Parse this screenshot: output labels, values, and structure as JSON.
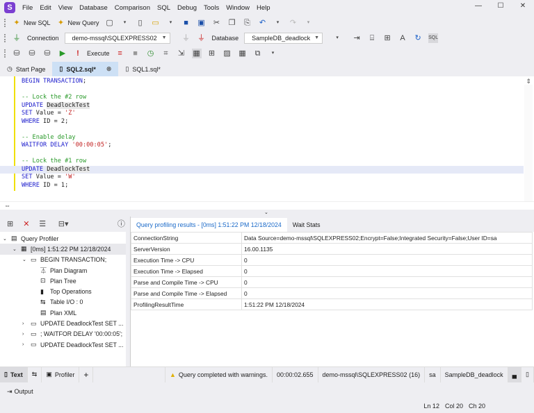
{
  "menu": [
    "File",
    "Edit",
    "View",
    "Database",
    "Comparison",
    "SQL",
    "Debug",
    "Tools",
    "Window",
    "Help"
  ],
  "toolbar": {
    "new_sql": "New SQL",
    "new_query": "New Query",
    "connection_label": "Connection",
    "connection_value": "demo-mssql\\SQLEXPRESS02",
    "database_label": "Database",
    "database_value": "SampleDB_deadlock",
    "execute": "Execute"
  },
  "tabs": [
    {
      "label": "Start Page"
    },
    {
      "label": "SQL2.sql*",
      "active": true
    },
    {
      "label": "SQL1.sql*"
    }
  ],
  "editor": {
    "lines": [
      [
        {
          "t": "BEGIN TRANSACTION",
          "c": "kw"
        },
        {
          "t": ";",
          "c": ""
        }
      ],
      [],
      [
        {
          "t": "-- Lock the #2 row",
          "c": "cm"
        }
      ],
      [
        {
          "t": "UPDATE ",
          "c": "kw"
        },
        {
          "t": "DeadlockTest",
          "c": "id"
        }
      ],
      [
        {
          "t": "SET ",
          "c": "kw"
        },
        {
          "t": "Value = ",
          "c": ""
        },
        {
          "t": "'Z'",
          "c": "st"
        }
      ],
      [
        {
          "t": "WHERE ",
          "c": "kw"
        },
        {
          "t": "ID = 2;",
          "c": ""
        }
      ],
      [],
      [
        {
          "t": "-- Enable delay",
          "c": "cm"
        }
      ],
      [
        {
          "t": "WAITFOR DELAY ",
          "c": "kw"
        },
        {
          "t": "'00:00:05'",
          "c": "st"
        },
        {
          "t": ";",
          "c": ""
        }
      ],
      [],
      [
        {
          "t": "-- Lock the #1 row",
          "c": "cm"
        }
      ],
      [
        {
          "t": "UPDATE ",
          "c": "kw"
        },
        {
          "t": "DeadlockTest",
          "c": "id"
        }
      ],
      [
        {
          "t": "SET ",
          "c": "kw"
        },
        {
          "t": "Value = ",
          "c": ""
        },
        {
          "t": "'W'",
          "c": "st"
        }
      ],
      [
        {
          "t": "WHERE ",
          "c": "kw"
        },
        {
          "t": "ID = 1;",
          "c": ""
        }
      ]
    ],
    "current_line": 12
  },
  "profiler": {
    "root": "Query Profiler",
    "session": "[0ms] 1:51:22 PM 12/18/2024",
    "statement": "BEGIN TRANSACTION;",
    "children": [
      "Plan Diagram",
      "Plan Tree",
      "Top Operations",
      "Table I/O : 0",
      "Plan XML"
    ],
    "others": [
      "UPDATE DeadlockTest   SET ...",
      "; WAITFOR DELAY '00:00:05';",
      "UPDATE DeadlockTest   SET ..."
    ]
  },
  "results": {
    "tabs": [
      "Query profiling results - [0ms] 1:51:22 PM 12/18/2024",
      "Wait Stats"
    ],
    "rows": [
      [
        "ConnectionString",
        "Data Source=demo-mssql\\SQLEXPRESS02;Encrypt=False;Integrated Security=False;User ID=sa"
      ],
      [
        "ServerVersion",
        "16.00.1135"
      ],
      [
        "Execution Time -> CPU",
        "0"
      ],
      [
        "Execution Time -> Elapsed",
        "0"
      ],
      [
        "Parse and Compile Time -> CPU",
        "0"
      ],
      [
        "Parse and Compile Time -> Elapsed",
        "0"
      ],
      [
        "ProfilingResultTime",
        "1:51:22 PM 12/18/2024"
      ]
    ]
  },
  "bottom": {
    "text_tab": "Text",
    "profiler_tab": "Profiler",
    "add": "+",
    "message": "Query completed with warnings.",
    "duration": "00:00:02.655",
    "server": "demo-mssql\\SQLEXPRESS02 (16)",
    "user": "sa",
    "database": "SampleDB_deadlock"
  },
  "output": "Output",
  "status": {
    "ln": "Ln 12",
    "col": "Col 20",
    "ch": "Ch 20"
  }
}
